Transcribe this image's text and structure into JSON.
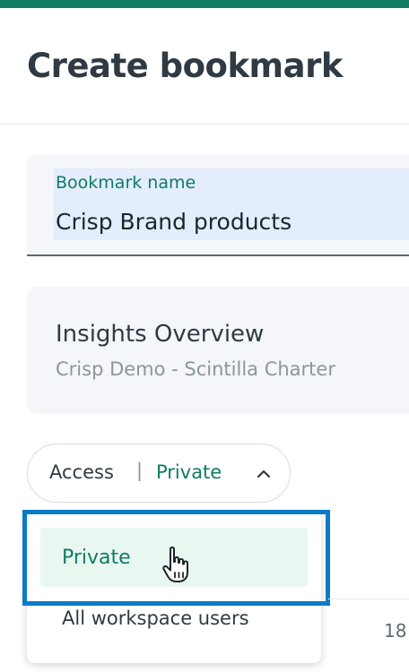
{
  "page": {
    "title": "Create bookmark",
    "accent_color": "#0f7c63",
    "highlight_color": "#0b7bc6"
  },
  "name_field": {
    "label": "Bookmark name",
    "value": "Crisp Brand products"
  },
  "dashboard": {
    "title": "Insights Overview",
    "subtitle": "Crisp Demo - Scintilla Charter"
  },
  "access": {
    "label": "Access",
    "separator": "|",
    "value": "Private",
    "icon": "chevron-up-icon"
  },
  "dropdown": {
    "options": [
      {
        "label": "Private",
        "selected": true
      },
      {
        "label": "All workspace users",
        "selected": false
      }
    ]
  },
  "background": {
    "count_text": "18"
  },
  "cursor": {
    "icon": "hand-pointer-icon"
  }
}
